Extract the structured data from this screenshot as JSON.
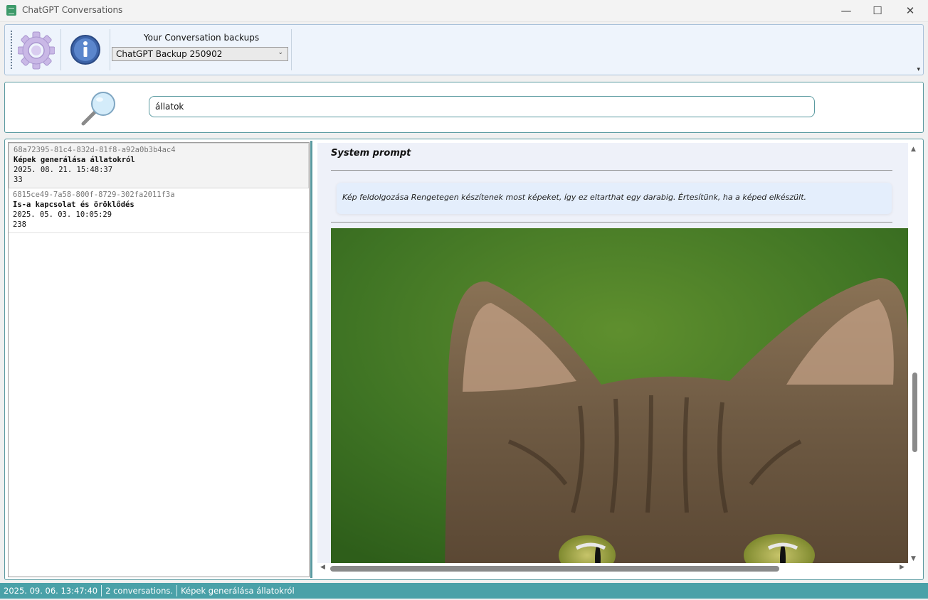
{
  "window": {
    "title": "ChatGPT Conversations",
    "minimize_glyph": "—",
    "maximize_glyph": "☐",
    "close_glyph": "✕"
  },
  "toolbar": {
    "settings_icon": "gear-icon",
    "info_icon": "info-icon",
    "backup_label": "Your Conversation backups",
    "backup_selected": "ChatGPT Backup 250902"
  },
  "search": {
    "icon": "magnifier-icon",
    "value": "állatok"
  },
  "conversations": [
    {
      "id": "68a72395-81c4-832d-81f8-a92a0b3b4ac4",
      "title": "Képek generálása állatokról",
      "date": "2025. 08. 21. 15:48:37",
      "count": "33"
    },
    {
      "id": "6815ce49-7a58-800f-8729-302fa2011f3a",
      "title": "Is-a kapcsolat és öröklődés",
      "date": "2025. 05. 03. 10:05:29",
      "count": "238"
    }
  ],
  "viewer": {
    "heading": "System prompt",
    "prompt_text": "Kép feldolgozása Rengetegen készítenek most képeket, így ez eltarthat egy darabig. Értesítünk, ha a képed elkészült.",
    "image": "cat-photo"
  },
  "status": {
    "timestamp": "2025. 09. 06. 13:47:40",
    "count_text": "2 conversations.",
    "current_title": "Képek generálása állatokról"
  },
  "colors": {
    "accent": "#4aa1a8",
    "toolbar_bg": "#eef4fc"
  }
}
